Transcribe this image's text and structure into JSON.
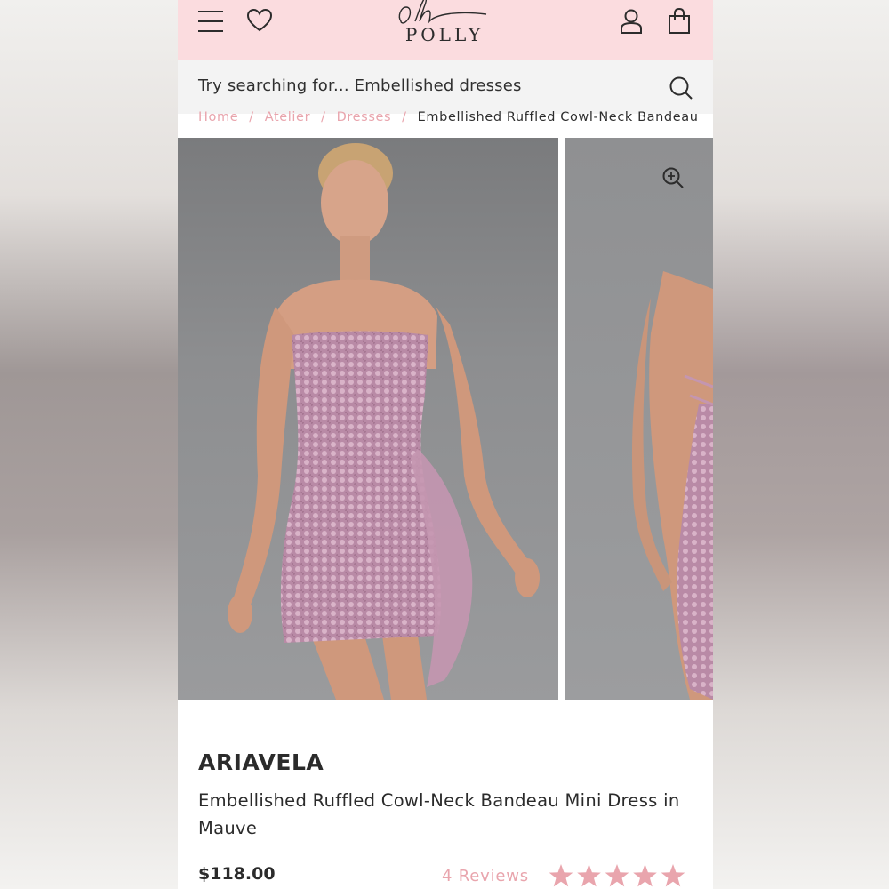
{
  "header": {
    "logo_script": "oh",
    "logo_word": "POLLY",
    "menu_icon": "hamburger-icon",
    "wishlist_icon": "heart-icon",
    "account_icon": "user-icon",
    "bag_icon": "shopping-bag-icon",
    "background_color": "#fbdcdf"
  },
  "search": {
    "placeholder": "Try searching for... Embellished dresses",
    "icon": "search-icon"
  },
  "breadcrumb": {
    "items": [
      "Home",
      "Atelier",
      "Dresses"
    ],
    "separator": "/",
    "current": "Embellished Ruffled Cowl-Neck Bandeau"
  },
  "gallery": {
    "zoom_icon": "zoom-in-icon",
    "images": [
      "front-view",
      "back-view"
    ]
  },
  "product": {
    "brand": "ARIAVELA",
    "name": "Embellished Ruffled Cowl-Neck Bandeau Mini Dress in Mauve",
    "price": "$118.00",
    "reviews_label": "4 Reviews",
    "rating": 5,
    "rating_max": 5,
    "star_color": "#e9a5ad",
    "accent_color": "#e9a5ad"
  }
}
